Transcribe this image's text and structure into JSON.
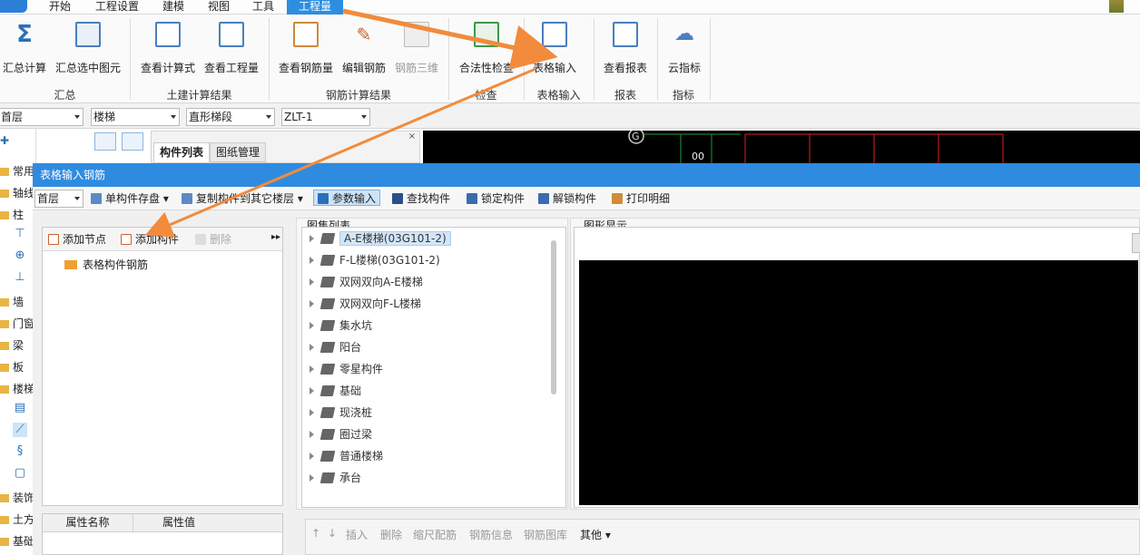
{
  "menu": [
    "开始",
    "工程设置",
    "建模",
    "视图",
    "工具",
    "工程量"
  ],
  "ribbon": {
    "groups": [
      {
        "label": "汇总",
        "buttons": [
          "汇总计算",
          "汇总选中图元"
        ]
      },
      {
        "label": "土建计算结果",
        "buttons": [
          "查看计算式",
          "查看工程量"
        ]
      },
      {
        "label": "钢筋计算结果",
        "buttons": [
          "查看钢筋量",
          "编辑钢筋",
          "钢筋三维"
        ]
      },
      {
        "label": "检查",
        "buttons": [
          "合法性检查"
        ]
      },
      {
        "label": "表格输入",
        "buttons": [
          "表格输入"
        ]
      },
      {
        "label": "报表",
        "buttons": [
          "查看报表"
        ]
      },
      {
        "label": "指标",
        "buttons": [
          "云指标"
        ]
      }
    ]
  },
  "combos": [
    "首层",
    "楼梯",
    "直形梯段",
    "ZLT-1"
  ],
  "leftnav": [
    "常用",
    "轴线",
    "柱",
    "墙",
    "门窗",
    "梁",
    "板",
    "楼梯",
    "装饰",
    "土方",
    "基础"
  ],
  "bgtabs": [
    "构件列表",
    "图纸管理"
  ],
  "dialog": {
    "title": "表格输入钢筋",
    "floor": "首层",
    "toolbar": [
      "单构件存盘",
      "复制构件到其它楼层",
      "参数输入",
      "查找构件",
      "锁定构件",
      "解锁构件",
      "打印明细"
    ],
    "tree_toolbar": [
      "添加节点",
      "添加构件",
      "删除"
    ],
    "tree_root": "表格构件钢筋",
    "prop_headers": [
      "属性名称",
      "属性值"
    ],
    "atlas_caption": "图集列表",
    "atlas": [
      "A-E楼梯(03G101-2)",
      "F-L楼梯(03G101-2)",
      "双网双向A-E楼梯",
      "双网双向F-L楼梯",
      "集水坑",
      "阳台",
      "零星构件",
      "基础",
      "现浇桩",
      "圈过梁",
      "普通楼梯",
      "承台"
    ],
    "graphic_caption": "图形显示",
    "bottom": [
      "插入",
      "删除",
      "缩尺配筋",
      "钢筋信息",
      "钢筋图库",
      "其他"
    ]
  },
  "colors": {
    "accent": "#2f8be0",
    "arrow": "#f28b3c"
  }
}
